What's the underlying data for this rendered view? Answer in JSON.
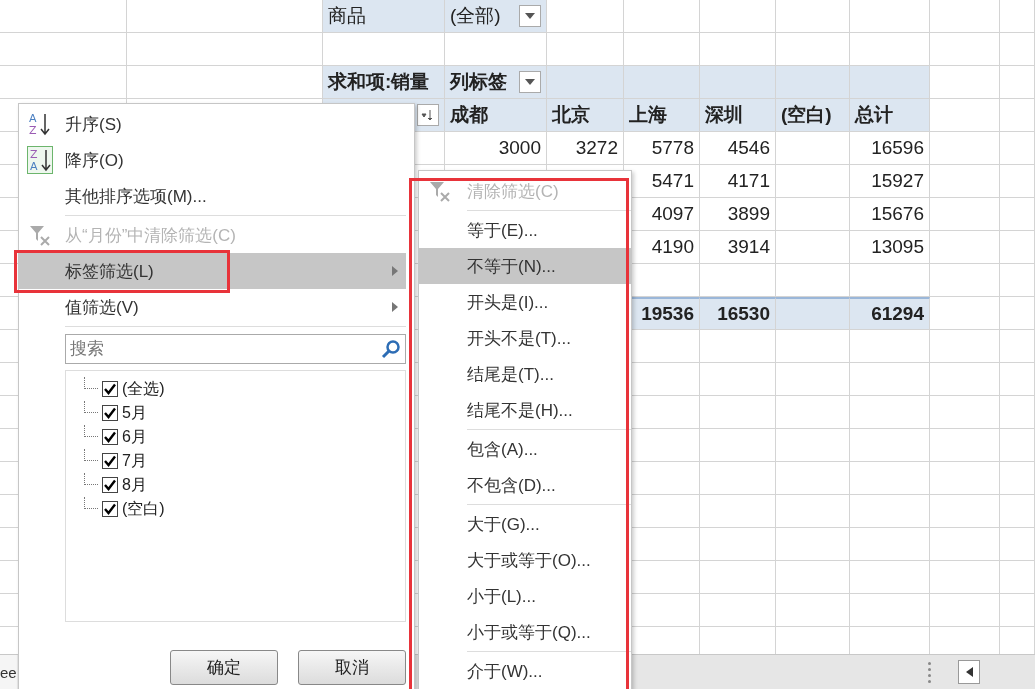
{
  "sheet": {
    "pivot": {
      "page_field": {
        "label": "商品",
        "value": "(全部)"
      },
      "value_field": "求和项:销量",
      "column_field": "列标签",
      "columns": [
        "成都",
        "北京",
        "上海",
        "深圳",
        "(空白)",
        "总计"
      ],
      "rows": [
        {
          "column_1": "3000",
          "column_2": "3272",
          "column_3": "5778",
          "column_4": "4546",
          "column_6": "16596"
        },
        {
          "column_3": "5471",
          "column_4": "4171",
          "column_6": "15927"
        },
        {
          "column_3": "4097",
          "column_4": "3899",
          "column_6": "15676"
        },
        {
          "column_3": "4190",
          "column_4": "3914",
          "column_6": "13095"
        }
      ],
      "total": {
        "column_3": "19536",
        "column_4": "16530",
        "column_6": "61294"
      }
    },
    "sheet_tab": "ee"
  },
  "filter_menu": {
    "items": [
      {
        "kind": "sort_asc",
        "icon_letters": [
          "A",
          "Z"
        ],
        "label": "升序(S)",
        "disabled": false,
        "highlighted": false
      },
      {
        "kind": "sort_desc",
        "icon_letters": [
          "Z",
          "A"
        ],
        "label": "降序(O)",
        "disabled": false,
        "highlighted": false
      },
      {
        "kind": "command",
        "label": "其他排序选项(M)...",
        "disabled": false,
        "highlighted": false
      },
      {
        "kind": "separator"
      },
      {
        "kind": "clear",
        "label": "从“月份”中清除筛选(C)",
        "disabled": true,
        "highlighted": false
      },
      {
        "kind": "submenu",
        "label": "标签筛选(L)",
        "disabled": false,
        "highlighted": true
      },
      {
        "kind": "submenu",
        "label": "值筛选(V)",
        "disabled": false,
        "highlighted": false
      },
      {
        "kind": "separator"
      }
    ],
    "search": {
      "placeholder": "搜索"
    },
    "values": [
      {
        "label": "(全选)",
        "checked": true
      },
      {
        "label": "5月",
        "checked": true
      },
      {
        "label": "6月",
        "checked": true
      },
      {
        "label": "7月",
        "checked": true
      },
      {
        "label": "8月",
        "checked": true
      },
      {
        "label": "(空白)",
        "checked": true
      }
    ],
    "buttons": [
      "确定",
      "取消"
    ]
  },
  "label_filter_menu": {
    "items": [
      {
        "kind": "clear",
        "label": "清除筛选(C)",
        "disabled": true,
        "highlighted": false
      },
      {
        "kind": "separator"
      },
      {
        "kind": "command",
        "label": "等于(E)...",
        "disabled": false,
        "highlighted": false
      },
      {
        "kind": "command",
        "label": "不等于(N)...",
        "disabled": false,
        "highlighted": true
      },
      {
        "kind": "command",
        "label": "开头是(I)...",
        "disabled": false,
        "highlighted": false
      },
      {
        "kind": "command",
        "label": "开头不是(T)...",
        "disabled": false,
        "highlighted": false
      },
      {
        "kind": "command",
        "label": "结尾是(T)...",
        "disabled": false,
        "highlighted": false
      },
      {
        "kind": "command",
        "label": "结尾不是(H)...",
        "disabled": false,
        "highlighted": false
      },
      {
        "kind": "separator"
      },
      {
        "kind": "command",
        "label": "包含(A)...",
        "disabled": false,
        "highlighted": false
      },
      {
        "kind": "command",
        "label": "不包含(D)...",
        "disabled": false,
        "highlighted": false
      },
      {
        "kind": "separator"
      },
      {
        "kind": "command",
        "label": "大于(G)...",
        "disabled": false,
        "highlighted": false
      },
      {
        "kind": "command",
        "label": "大于或等于(O)...",
        "disabled": false,
        "highlighted": false
      },
      {
        "kind": "command",
        "label": "小于(L)...",
        "disabled": false,
        "highlighted": false
      },
      {
        "kind": "command",
        "label": "小于或等于(Q)...",
        "disabled": false,
        "highlighted": false
      },
      {
        "kind": "separator"
      },
      {
        "kind": "command",
        "label": "介于(W)...",
        "disabled": false,
        "highlighted": false
      }
    ]
  }
}
